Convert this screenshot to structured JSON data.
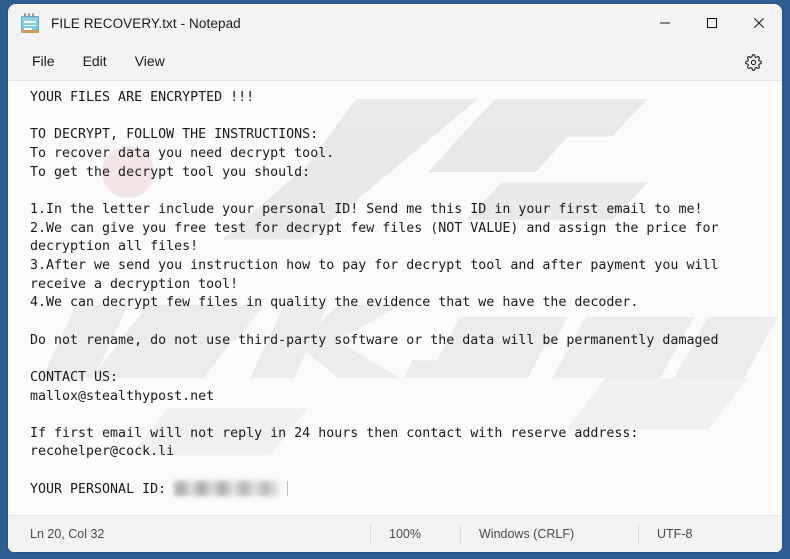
{
  "window": {
    "title": "FILE RECOVERY.txt - Notepad",
    "app_icon": "notepad-icon",
    "border_color": "#2e5d92",
    "chrome_color": "#f3f3f3"
  },
  "titlebar_controls": {
    "minimize_label": "Minimize",
    "maximize_label": "Maximize",
    "close_label": "Close"
  },
  "menubar": {
    "items": [
      {
        "label": "File"
      },
      {
        "label": "Edit"
      },
      {
        "label": "View"
      }
    ],
    "settings_icon": "gear-icon",
    "settings_label": "Settings"
  },
  "document": {
    "content": "YOUR FILES ARE ENCRYPTED !!!\n\nTO DECRYPT, FOLLOW THE INSTRUCTIONS:\nTo recover data you need decrypt tool.\nTo get the decrypt tool you should:\n\n1.In the letter include your personal ID! Send me this ID in your first email to me!\n2.We can give you free test for decrypt few files (NOT VALUE) and assign the price for\ndecryption all files!\n3.After we send you instruction how to pay for decrypt tool and after payment you will\nreceive a decryption tool!\n4.We can decrypt few files in quality the evidence that we have the decoder.\n\nDo not rename, do not use third-party software or the data will be permanently damaged\n\nCONTACT US:\nmallox@stealthypost.net\n\nIf first email will not reply in 24 hours then contact with reserve address:\nrecohelper@cock.li\n\nYOUR PERSONAL ID: ",
    "personal_id_label": "YOUR PERSONAL ID:",
    "personal_id_value": "[redacted]",
    "contact_email_primary": "mallox@stealthypost.net",
    "contact_email_reserve": "recohelper@cock.li",
    "text_color": "#1a1a1a",
    "background_color": "#fbfbfb"
  },
  "watermark": {
    "text": "pcrisk.com",
    "visible_fragment": "isk.com"
  },
  "statusbar": {
    "position": "Ln 20, Col 32",
    "zoom": "100%",
    "line_ending": "Windows (CRLF)",
    "encoding": "UTF-8"
  }
}
